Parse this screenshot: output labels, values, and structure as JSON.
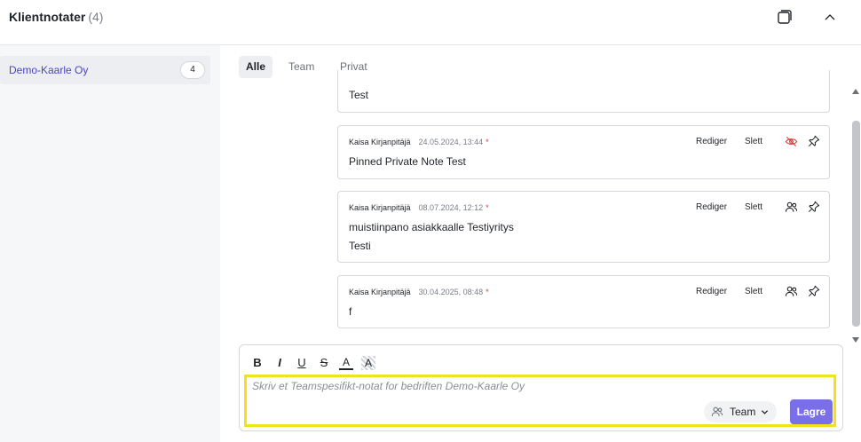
{
  "header": {
    "title": "Klientnotater",
    "count": "(4)"
  },
  "sidebar": {
    "clients": [
      {
        "name": "Demo-Kaarle Oy",
        "badge": "4"
      }
    ]
  },
  "tabs": [
    {
      "label": "Alle",
      "active": true
    },
    {
      "label": "Team",
      "active": false
    },
    {
      "label": "Privat",
      "active": false
    }
  ],
  "notes": [
    {
      "text": [
        "Test"
      ]
    },
    {
      "author": "Kaisa Kirjanpitäjä",
      "timestamp": "24.05.2024, 13:44",
      "marker": "*",
      "text": [
        "Pinned Private Note Test"
      ],
      "edit": "Rediger",
      "delete": "Slett",
      "visibility": "private"
    },
    {
      "author": "Kaisa Kirjanpitäjä",
      "timestamp": "08.07.2024, 12:12",
      "marker": "*",
      "text": [
        "muistiinpano asiakkaalle Testiyritys",
        "Testi"
      ],
      "edit": "Rediger",
      "delete": "Slett",
      "visibility": "team"
    },
    {
      "author": "Kaisa Kirjanpitäjä",
      "timestamp": "30.04.2025, 08:48",
      "marker": "*",
      "text": [
        "f"
      ],
      "edit": "Rediger",
      "delete": "Slett",
      "visibility": "team"
    }
  ],
  "editor": {
    "toolbar": {
      "bold": "B",
      "italic": "I",
      "underline": "U",
      "strike": "S",
      "font_color": "A",
      "highlight": "A"
    },
    "placeholder": "Skriv et Teamspesifikt-notat for bedriften Demo-Kaarle Oy",
    "visibility_label": "Team",
    "save_label": "Lagre"
  },
  "colors": {
    "accent": "#7b6fe8",
    "link": "#4c45c2",
    "private_icon": "#d23b3b",
    "highlight_frame": "#f3e11b"
  },
  "icons": {
    "window": "restore-window-icon",
    "collapse": "chevron-up-icon",
    "private": "eye-off-icon",
    "team": "users-icon",
    "pin": "pin-icon"
  }
}
